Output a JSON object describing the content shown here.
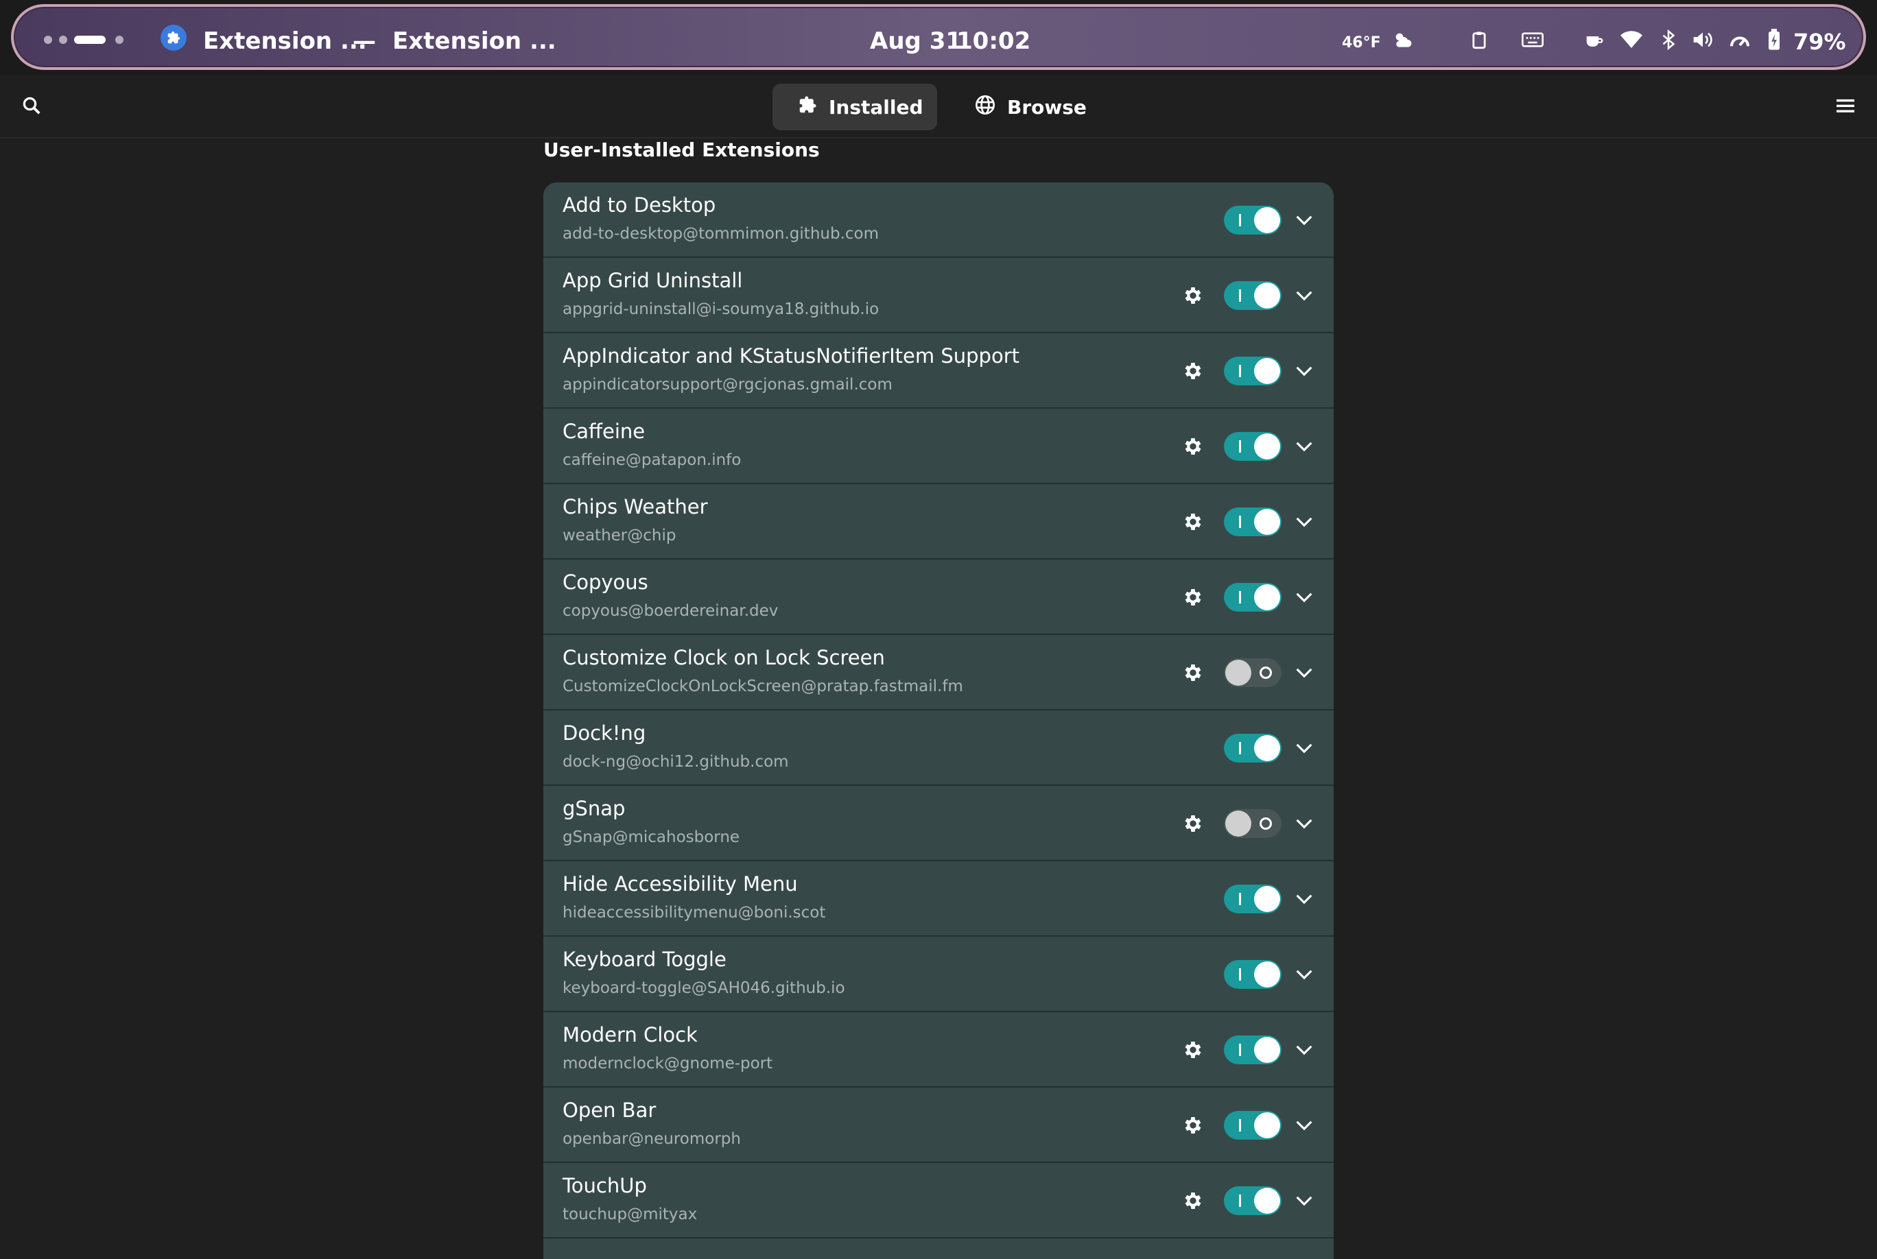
{
  "topbar": {
    "app_title": "Extension ...",
    "separator": "—",
    "window_title": "Extension ...",
    "date": "Aug 31",
    "time": "10:02",
    "temperature": "46°F",
    "battery": "79%",
    "icons": [
      "weather-icon",
      "clipboard-icon",
      "keyboard-icon",
      "caffeine-cup-icon",
      "wifi-icon",
      "bluetooth-icon",
      "volume-icon",
      "power-mode-icon",
      "battery-icon"
    ]
  },
  "header": {
    "tabs": [
      {
        "label": "Installed",
        "icon": "puzzle-icon",
        "active": true
      },
      {
        "label": "Browse",
        "icon": "globe-icon",
        "active": false
      }
    ]
  },
  "section_title": "User-Installed Extensions",
  "extensions": [
    {
      "name": "Add to Desktop",
      "id": "add-to-desktop@tommimon.github.com",
      "settings": false,
      "enabled": true
    },
    {
      "name": "App Grid Uninstall",
      "id": "appgrid-uninstall@i-soumya18.github.io",
      "settings": true,
      "enabled": true
    },
    {
      "name": "AppIndicator and KStatusNotifierItem Support",
      "id": "appindicatorsupport@rgcjonas.gmail.com",
      "settings": true,
      "enabled": true
    },
    {
      "name": "Caffeine",
      "id": "caffeine@patapon.info",
      "settings": true,
      "enabled": true
    },
    {
      "name": "Chips Weather",
      "id": "weather@chip",
      "settings": true,
      "enabled": true
    },
    {
      "name": "Copyous",
      "id": "copyous@boerdereinar.dev",
      "settings": true,
      "enabled": true
    },
    {
      "name": "Customize Clock on Lock Screen",
      "id": "CustomizeClockOnLockScreen@pratap.fastmail.fm",
      "settings": true,
      "enabled": false
    },
    {
      "name": "Dock!ng",
      "id": "dock-ng@ochi12.github.com",
      "settings": false,
      "enabled": true
    },
    {
      "name": "gSnap",
      "id": "gSnap@micahosborne",
      "settings": true,
      "enabled": false
    },
    {
      "name": "Hide Accessibility Menu",
      "id": "hideaccessibilitymenu@boni.scot",
      "settings": false,
      "enabled": true
    },
    {
      "name": "Keyboard Toggle",
      "id": "keyboard-toggle@SAH046.github.io",
      "settings": false,
      "enabled": true
    },
    {
      "name": "Modern Clock",
      "id": "modernclock@gnome-port",
      "settings": true,
      "enabled": true
    },
    {
      "name": "Open Bar",
      "id": "openbar@neuromorph",
      "settings": true,
      "enabled": true
    },
    {
      "name": "TouchUp",
      "id": "touchup@mityax",
      "settings": true,
      "enabled": true
    }
  ],
  "colors": {
    "accent": "#1a9a9a",
    "row_bg": "#374848",
    "window_bg": "#1f1f1f"
  }
}
